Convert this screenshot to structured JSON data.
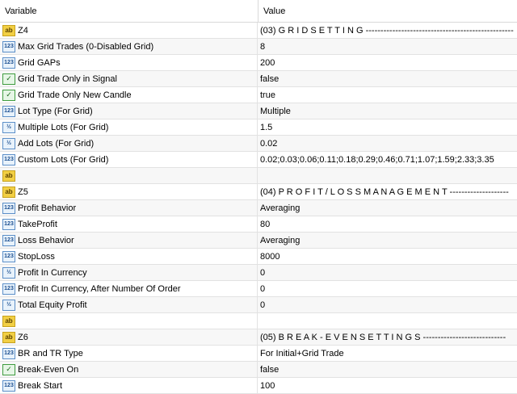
{
  "header": {
    "variable": "Variable",
    "value": "Value"
  },
  "rows": [
    {
      "icon": "abc-icon",
      "variable": "Z4",
      "value": "(03) G R I D   S E T T I N G --------------------------------------------------"
    },
    {
      "icon": "int-icon",
      "variable": "Max Grid Trades (0-Disabled Grid)",
      "value": "8"
    },
    {
      "icon": "int-icon",
      "variable": "Grid GAPs",
      "value": "200"
    },
    {
      "icon": "bool-icon",
      "variable": "Grid Trade Only in Signal",
      "value": "false"
    },
    {
      "icon": "bool-icon",
      "variable": "Grid Trade Only New Candle",
      "value": "true"
    },
    {
      "icon": "int-icon",
      "variable": "Lot Type (For Grid)",
      "value": "Multiple"
    },
    {
      "icon": "frac-icon",
      "variable": "Multiple Lots (For Grid)",
      "value": "1.5"
    },
    {
      "icon": "frac-icon",
      "variable": "Add Lots (For Grid)",
      "value": "0.02"
    },
    {
      "icon": "int-icon",
      "variable": "Custom Lots (For Grid)",
      "value": "0.02;0.03;0.06;0.11;0.18;0.29;0.46;0.71;1.07;1.59;2.33;3.35"
    },
    {
      "icon": "abc-icon",
      "variable": "",
      "value": ""
    },
    {
      "icon": "abc-icon",
      "variable": "Z5",
      "value": "(04) P R O F I T / L O S S   M A N A G E M E N T --------------------"
    },
    {
      "icon": "int-icon",
      "variable": "Profit Behavior",
      "value": "Averaging"
    },
    {
      "icon": "int-icon",
      "variable": "TakeProfit",
      "value": "80"
    },
    {
      "icon": "int-icon",
      "variable": "Loss Behavior",
      "value": "Averaging"
    },
    {
      "icon": "int-icon",
      "variable": "StopLoss",
      "value": "8000"
    },
    {
      "icon": "frac-icon",
      "variable": "Profit In Currency",
      "value": "0"
    },
    {
      "icon": "int-icon",
      "variable": "Profit In Currency, After Number Of Order",
      "value": "0"
    },
    {
      "icon": "frac-icon",
      "variable": "Total Equity Profit",
      "value": "0"
    },
    {
      "icon": "abc-icon",
      "variable": "",
      "value": ""
    },
    {
      "icon": "abc-icon",
      "variable": "Z6",
      "value": "(05) B R E A K - E V E N   S E T T I N G S ----------------------------"
    },
    {
      "icon": "int-icon",
      "variable": "BR and TR Type",
      "value": "For Initial+Grid Trade"
    },
    {
      "icon": "bool-icon",
      "variable": "Break-Even On",
      "value": "false"
    },
    {
      "icon": "int-icon",
      "variable": "Break Start",
      "value": "100"
    }
  ]
}
